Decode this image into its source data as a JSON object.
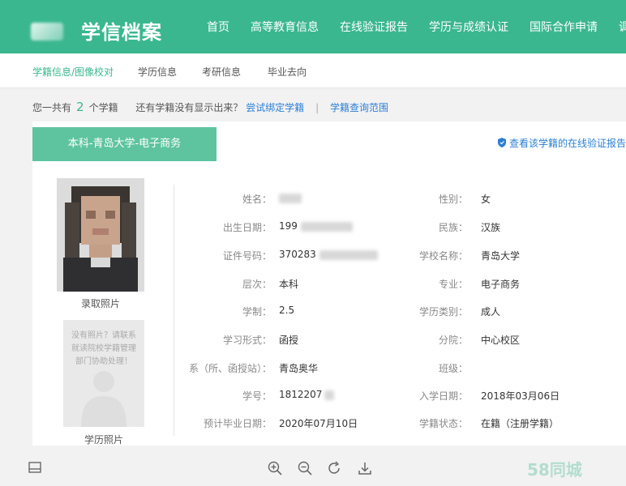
{
  "header": {
    "logo_text": "学信档案",
    "nav": [
      "首页",
      "高等教育信息",
      "在线验证报告",
      "学历与成绩认证",
      "国际合作申请",
      "调查/投"
    ]
  },
  "subnav": [
    "学籍信息/图像校对",
    "学历信息",
    "考研信息",
    "毕业去向"
  ],
  "summary": {
    "prefix": "您一共有",
    "count": "2",
    "suffix": "个学籍",
    "question": "还有学籍没有显示出来？",
    "bind_link": "尝试绑定学籍",
    "separator": "|",
    "scope_link": "学籍查询范围"
  },
  "record": {
    "tab_title": "本科-青岛大学-电子商务",
    "verify_link": "查看该学籍的在线验证报告",
    "photo_label": "录取照片",
    "placeholder_text": "没有照片？请联系就读院校学籍管理部门协助处理！",
    "placeholder_label": "学历照片",
    "fields": [
      {
        "label": "姓名：",
        "value": ""
      },
      {
        "label": "性别：",
        "value": "女"
      },
      {
        "label": "出生日期：",
        "value": "199"
      },
      {
        "label": "民族：",
        "value": "汉族"
      },
      {
        "label": "证件号码：",
        "value": "370283"
      },
      {
        "label": "学校名称：",
        "value": "青岛大学"
      },
      {
        "label": "层次：",
        "value": "本科"
      },
      {
        "label": "专业：",
        "value": "电子商务"
      },
      {
        "label": "学制：",
        "value": "2.5"
      },
      {
        "label": "学历类别：",
        "value": "成人"
      },
      {
        "label": "学习形式：",
        "value": "函授"
      },
      {
        "label": "分院：",
        "value": "中心校区"
      },
      {
        "label": "系（所、函授站）：",
        "value": "青岛奥华"
      },
      {
        "label": "班级：",
        "value": ""
      },
      {
        "label": "学号：",
        "value": "1812207"
      },
      {
        "label": "入学日期：",
        "value": "2018年03月06日"
      },
      {
        "label": "预计毕业日期：",
        "value": "2020年07月10日"
      },
      {
        "label": "学籍状态：",
        "value": "在籍（注册学籍）"
      }
    ]
  },
  "colors": {
    "brand_green": "#3ab78f",
    "tab_green": "#5ec4a0",
    "link_blue": "#2a7fd4"
  },
  "toolbar": {
    "icons": [
      "sidebar-toggle-icon",
      "zoom-in-icon",
      "zoom-out-icon",
      "rotate-icon",
      "download-icon"
    ]
  },
  "watermark": "58同城"
}
